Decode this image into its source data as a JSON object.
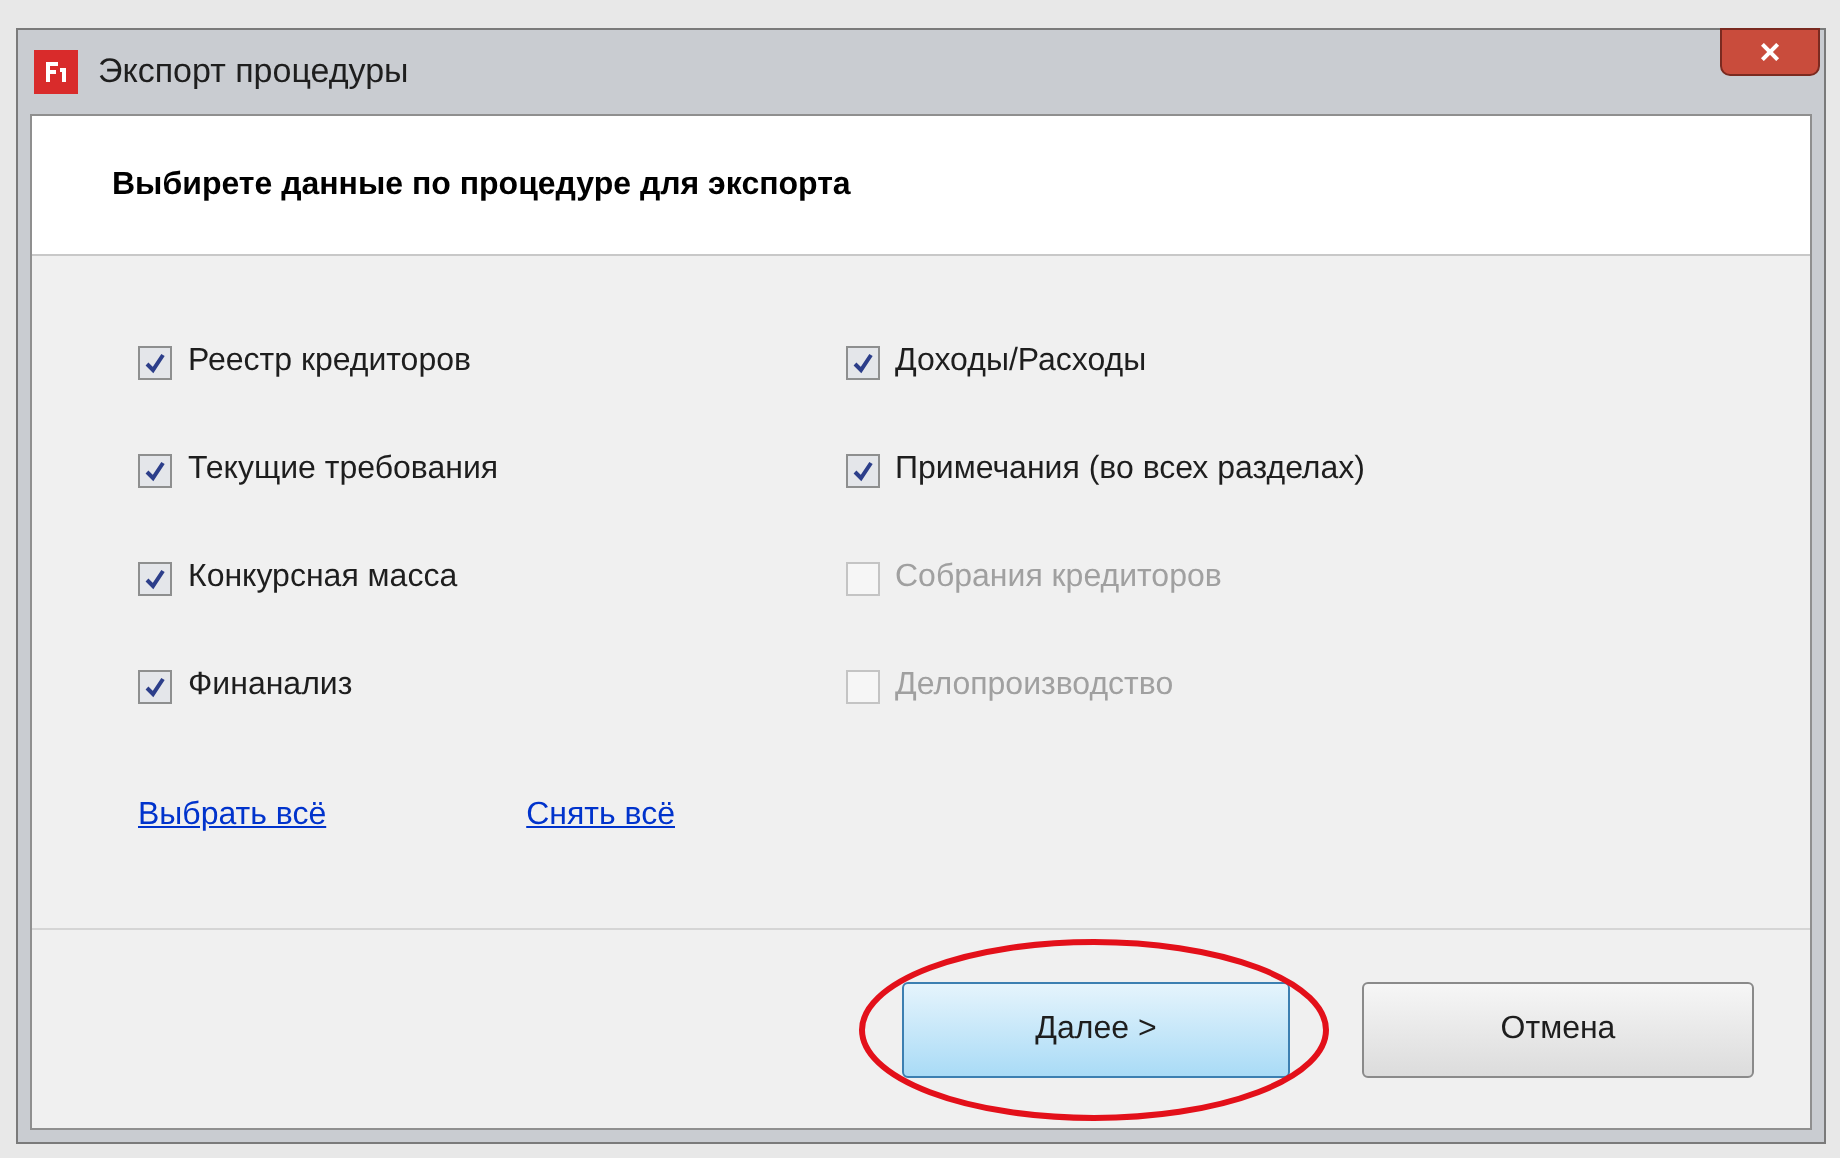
{
  "window": {
    "title": "Экспорт процедуры",
    "close": "×"
  },
  "header": "Выбирете данные по процедуре для экспорта",
  "options": [
    {
      "label": "Реестр кредиторов",
      "checked": true,
      "disabled": false
    },
    {
      "label": "Текущие требования",
      "checked": true,
      "disabled": false
    },
    {
      "label": "Конкурсная масса",
      "checked": true,
      "disabled": false
    },
    {
      "label": "Финанализ",
      "checked": true,
      "disabled": false
    },
    {
      "label": "Доходы/Расходы",
      "checked": true,
      "disabled": false
    },
    {
      "label": "Примечания (во всех разделах)",
      "checked": true,
      "disabled": false
    },
    {
      "label": "Собрания кредиторов",
      "checked": false,
      "disabled": true
    },
    {
      "label": "Делопроизводство",
      "checked": false,
      "disabled": true
    }
  ],
  "links": [
    "Выбрать всё",
    "Снять всё"
  ],
  "buttons": [
    {
      "label": "Далее >",
      "default": true,
      "annotated": true
    },
    {
      "label": "Отмена",
      "default": false,
      "annotated": false
    }
  ]
}
